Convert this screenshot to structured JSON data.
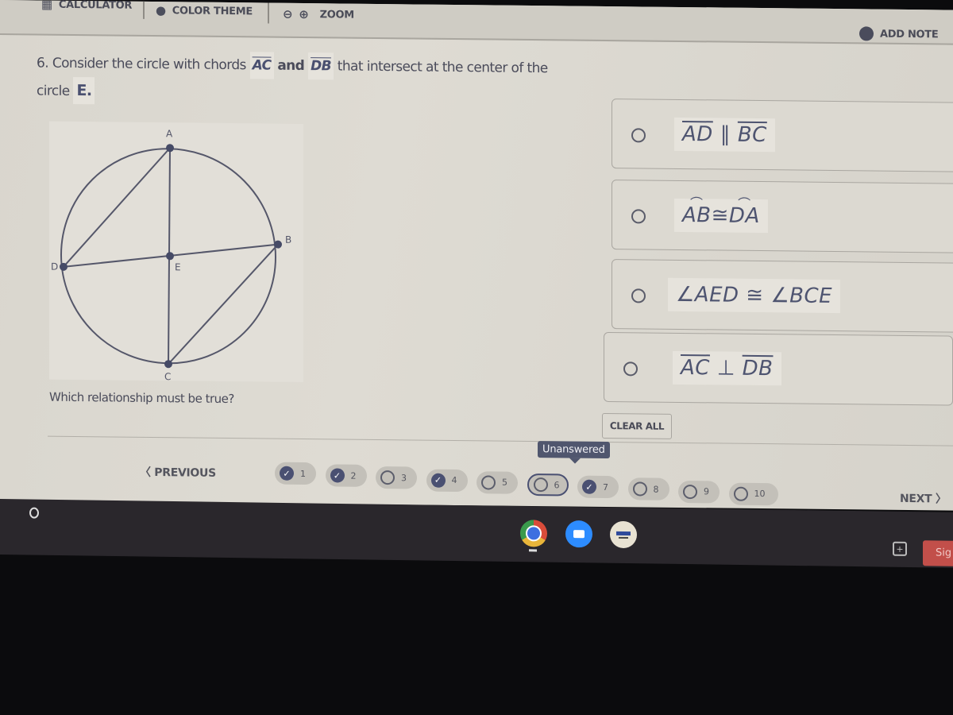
{
  "toolbar": {
    "calculator_label": "CALCULATOR",
    "color_theme_label": "COLOR THEME",
    "zoom_label": "ZOOM",
    "add_note_label": "ADD NOTE"
  },
  "question": {
    "number": "6.",
    "text_1": "Consider the circle with chords",
    "chord_1": "AC",
    "and": "and",
    "chord_2": "DB",
    "text_2": "that intersect at the center of the circle",
    "center": "E.",
    "prompt": "Which relationship must be true?"
  },
  "diagram": {
    "points": {
      "A": "A",
      "B": "B",
      "C": "C",
      "D": "D",
      "E": "E"
    }
  },
  "choices": [
    {
      "id": "a",
      "left": "AD",
      "op": " ∥ ",
      "right": "BC",
      "style": "segment",
      "selected": false
    },
    {
      "id": "b",
      "left": "AB",
      "op": "≅",
      "right": "DA",
      "style": "arc",
      "selected": false
    },
    {
      "id": "c",
      "left": "∠AED",
      "op": " ≅ ",
      "right": "∠BCE",
      "style": "angle",
      "selected": false
    },
    {
      "id": "d",
      "left": "AC",
      "op": " ⊥ ",
      "right": "DB",
      "style": "segment",
      "selected": false
    }
  ],
  "clear_all_label": "CLEAR ALL",
  "nav": {
    "previous_label": "PREVIOUS",
    "next_label": "NEXT",
    "tooltip": "Unanswered",
    "questions": [
      {
        "n": "1",
        "answered": true
      },
      {
        "n": "2",
        "answered": true
      },
      {
        "n": "3",
        "answered": false
      },
      {
        "n": "4",
        "answered": true
      },
      {
        "n": "5",
        "answered": false
      },
      {
        "n": "6",
        "answered": false,
        "current": true
      },
      {
        "n": "7",
        "answered": true
      },
      {
        "n": "8",
        "answered": false
      },
      {
        "n": "9",
        "answered": false
      },
      {
        "n": "10",
        "answered": false
      }
    ]
  },
  "shelf": {
    "apps": [
      "chrome-icon",
      "zoom-app-icon",
      "app-icon"
    ],
    "sign_label": "Sig"
  }
}
